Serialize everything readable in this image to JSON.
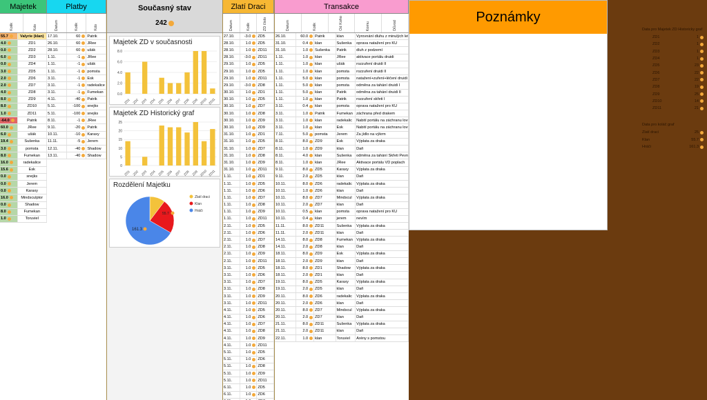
{
  "majetek": {
    "title": "Majetek",
    "h": [
      "Kolik",
      "Kdo"
    ],
    "rows": [
      [
        "55.7",
        "Valyrie (klan)"
      ],
      [
        "4.0",
        "ZD1"
      ],
      [
        "0.0",
        "ZD2"
      ],
      [
        "6.0",
        "ZD3"
      ],
      [
        "0.0",
        "ZD4"
      ],
      [
        "3.0",
        "ZD5"
      ],
      [
        "2.0",
        "ZD6"
      ],
      [
        "2.0",
        "ZD7"
      ],
      [
        "4.0",
        "ZD8"
      ],
      [
        "8.0",
        "ZD9"
      ],
      [
        "8.0",
        "ZD10"
      ],
      [
        "1.0",
        "ZD11"
      ],
      [
        "-64.0",
        "Patrik"
      ],
      [
        "60.0",
        "JRee"
      ],
      [
        "6.0",
        "ušák"
      ],
      [
        "19.4",
        "Sušenka"
      ],
      [
        "3.0",
        "pomsta"
      ],
      [
        "8.0",
        "Fumekan"
      ],
      [
        "16.0",
        "radekalice"
      ],
      [
        "15.6",
        "Esk"
      ],
      [
        "0.0",
        "snejks"
      ],
      [
        "0.0",
        "Jerem"
      ],
      [
        "0.0",
        "Karaxy"
      ],
      [
        "16.0",
        "Mindsculptor"
      ],
      [
        "0.0",
        "Shadow"
      ],
      [
        "8.0",
        "Fumekan"
      ],
      [
        "1.0",
        "Toruviel"
      ]
    ]
  },
  "platby": {
    "title": "Platby",
    "h": [
      "Datum",
      "Kolik",
      "Kdo"
    ],
    "rows": [
      [
        "17.10.",
        "60",
        "Patrik"
      ],
      [
        "26.10.",
        "60",
        "JRee"
      ],
      [
        "28.10.",
        "60",
        "ušák"
      ],
      [
        "1.11.",
        "-1",
        "JRee"
      ],
      [
        "1.11.",
        "-1",
        "ušák"
      ],
      [
        "1.11.",
        "-1",
        "pomsta"
      ],
      [
        "3.11.",
        "-1",
        "Esk"
      ],
      [
        "3.11.",
        "-1",
        "radekalice"
      ],
      [
        "3.11.",
        "-1",
        "Fumekan"
      ],
      [
        "4.11.",
        "-40",
        "Patrik"
      ],
      [
        "5.11.",
        "-100",
        "snejks"
      ],
      [
        "5.11.",
        "-100",
        "snejks"
      ],
      [
        "8.11.",
        "-1",
        "JRee"
      ],
      [
        "9.11.",
        "-20",
        "Patrik"
      ],
      [
        "10.11.",
        "-10",
        "Karaxy"
      ],
      [
        "11.11.",
        "-5",
        "Jerem"
      ],
      [
        "12.11.",
        "-40",
        "Shadow"
      ],
      [
        "13.11.",
        "-40",
        "Shadow"
      ]
    ]
  },
  "stav": {
    "title": "Současný stav",
    "value": "242"
  },
  "charts": {
    "c1_title": "Majetek ZD v současnosti",
    "c2_title": "Majetek ZD Historický graf",
    "c3_title": "Rozdělení Majetku",
    "pie_label1": "161.3",
    "pie_label2": "55.7"
  },
  "chart_data": [
    {
      "type": "bar",
      "categories": [
        "ZD1",
        "ZD2",
        "ZD3",
        "ZD4",
        "ZD5",
        "ZD6",
        "ZD7",
        "ZD8",
        "ZD9",
        "ZD10",
        "ZD11"
      ],
      "values": [
        4,
        0,
        6,
        0,
        3,
        2,
        2,
        4,
        8,
        8,
        1
      ],
      "ylim": [
        0,
        8
      ],
      "yticks": [
        "0.0",
        "2.0",
        "4.0",
        "6.0",
        "8.0"
      ],
      "color": "#f3c23b"
    },
    {
      "type": "bar",
      "categories": [
        "ZD1",
        "ZD2",
        "ZD3",
        "ZD4",
        "ZD5",
        "ZD6",
        "ZD7",
        "ZD8",
        "ZD9",
        "ZD10",
        "ZD11"
      ],
      "values": [
        14,
        0,
        5,
        0,
        23,
        22,
        22,
        19,
        25,
        14,
        21
      ],
      "ylim": [
        0,
        25
      ],
      "yticks": [
        "0",
        "5",
        "10",
        "15",
        "20",
        "25"
      ],
      "color": "#f3c23b"
    },
    {
      "type": "pie",
      "labels": [
        "Zlatí draci",
        "Klan",
        "Hráči"
      ],
      "values": [
        25,
        55.7,
        161.3
      ],
      "colors": [
        "#f3c23b",
        "#e8191d",
        "#4a86e8"
      ]
    }
  ],
  "draci": {
    "title": "Zlatí Draci",
    "h": [
      "Datum",
      "Kolik",
      "ZD číslo"
    ],
    "rows": [
      [
        "27.10.",
        "-3.0",
        "ZD5"
      ],
      [
        "28.10.",
        "1.0",
        "ZD5"
      ],
      [
        "28.10.",
        "1.0",
        "ZD11"
      ],
      [
        "28.10.",
        "-3.0",
        "ZD11"
      ],
      [
        "29.10.",
        "1.0",
        "ZD5"
      ],
      [
        "29.10.",
        "1.0",
        "ZD5"
      ],
      [
        "29.10.",
        "1.0",
        "ZD11"
      ],
      [
        "29.10.",
        "-3.0",
        "ZD8"
      ],
      [
        "30.10.",
        "1.0",
        "ZD1"
      ],
      [
        "30.10.",
        "1.0",
        "ZD5"
      ],
      [
        "30.10.",
        "1.0",
        "ZD7"
      ],
      [
        "30.10.",
        "1.0",
        "ZD8"
      ],
      [
        "30.10.",
        "1.0",
        "ZD9"
      ],
      [
        "30.10.",
        "1.0",
        "ZD9"
      ],
      [
        "31.10.",
        "1.0",
        "ZD1"
      ],
      [
        "31.10.",
        "1.0",
        "ZD5"
      ],
      [
        "31.10.",
        "1.0",
        "ZD7"
      ],
      [
        "31.10.",
        "1.0",
        "ZD8"
      ],
      [
        "31.10.",
        "1.0",
        "ZD9"
      ],
      [
        "31.10.",
        "1.0",
        "ZD11"
      ],
      [
        "1.11.",
        "1.0",
        "ZD1"
      ],
      [
        "1.11.",
        "1.0",
        "ZD5"
      ],
      [
        "1.11.",
        "1.0",
        "ZD6"
      ],
      [
        "1.11.",
        "1.0",
        "ZD7"
      ],
      [
        "1.11.",
        "1.0",
        "ZD8"
      ],
      [
        "1.11.",
        "1.0",
        "ZD9"
      ],
      [
        "1.11.",
        "1.0",
        "ZD11"
      ],
      [
        "2.11.",
        "1.0",
        "ZD5"
      ],
      [
        "2.11.",
        "1.0",
        "ZD6"
      ],
      [
        "2.11.",
        "1.0",
        "ZD7"
      ],
      [
        "2.11.",
        "1.0",
        "ZD8"
      ],
      [
        "2.11.",
        "1.0",
        "ZD9"
      ],
      [
        "2.11.",
        "1.0",
        "ZD11"
      ],
      [
        "3.11.",
        "1.0",
        "ZD5"
      ],
      [
        "3.11.",
        "1.0",
        "ZD6"
      ],
      [
        "3.11.",
        "1.0",
        "ZD7"
      ],
      [
        "3.11.",
        "1.0",
        "ZD8"
      ],
      [
        "3.11.",
        "1.0",
        "ZD9"
      ],
      [
        "3.11.",
        "1.0",
        "ZD11"
      ],
      [
        "4.11.",
        "1.0",
        "ZD5"
      ],
      [
        "4.11.",
        "1.0",
        "ZD6"
      ],
      [
        "4.11.",
        "1.0",
        "ZD7"
      ],
      [
        "4.11.",
        "1.0",
        "ZD8"
      ],
      [
        "4.11.",
        "1.0",
        "ZD9"
      ],
      [
        "4.11.",
        "1.0",
        "ZD11"
      ],
      [
        "5.11.",
        "1.0",
        "ZD5"
      ],
      [
        "5.11.",
        "1.0",
        "ZD6"
      ],
      [
        "5.11.",
        "1.0",
        "ZD8"
      ],
      [
        "5.11.",
        "1.0",
        "ZD9"
      ],
      [
        "5.11.",
        "1.0",
        "ZD11"
      ],
      [
        "6.11.",
        "1.0",
        "ZD5"
      ],
      [
        "6.11.",
        "1.0",
        "ZD6"
      ],
      [
        "6.11.",
        "1.0",
        "ZD7"
      ]
    ]
  },
  "transakce": {
    "title": "Transakce",
    "h": [
      "Datum",
      "Kolik",
      "Od Koho",
      "Komu",
      "Důvod"
    ],
    "rows": [
      [
        "26.10.",
        "60.0",
        "Patrik",
        "klan",
        "Vyrovnání dluhu z minulých let"
      ],
      [
        "31.10.",
        "0.4",
        "klan",
        "Sušenka",
        "oprava natažení pro KU"
      ],
      [
        "31.10.",
        "1.0",
        "Sušenka",
        "Patrik",
        "dluh z podzemí"
      ],
      [
        "1.11.",
        "1.0",
        "klan",
        "JRee",
        "aktivace portálu druidi"
      ],
      [
        "1.11.",
        "1.0",
        "klan",
        "ušák",
        "rozzuření druidi II"
      ],
      [
        "1.11.",
        "1.0",
        "klan",
        "pomsta",
        "rozzuření druidi II"
      ],
      [
        "1.11.",
        "5.0",
        "klan",
        "pomsta",
        "natažení+zuření+léčení druidi I"
      ],
      [
        "1.11.",
        "5.0",
        "klan",
        "pomsta",
        "odměna za tahání druidi I"
      ],
      [
        "1.11.",
        "5.0",
        "klan",
        "Patrik",
        "odměna za tahání druidi II"
      ],
      [
        "1.11.",
        "1.0",
        "klan",
        "Patrik",
        "rozzuření skřeti I"
      ],
      [
        "3.11.",
        "0.4",
        "klan",
        "pomsta",
        "oprava natažení pro KU"
      ],
      [
        "3.11.",
        "1.0",
        "Patrik",
        "Fumekan",
        "záchrana před drakem"
      ],
      [
        "3.11.",
        "1.0",
        "klan",
        "radekalic",
        "Nabití portálu na záchranu lovu"
      ],
      [
        "3.11.",
        "1.0",
        "klan",
        "Esk",
        "Nabití portálu na záchranu lovu"
      ],
      [
        "7.11.",
        "5.0",
        "pomsta",
        "Jerem",
        "Za jídlo na výkrm"
      ],
      [
        "8.11.",
        "8.0",
        "ZD9",
        "Esk",
        "Výplata za draka"
      ],
      [
        "8.11.",
        "1.0",
        "ZD9",
        "klan",
        "Daň"
      ],
      [
        "8.11.",
        "4.0",
        "klan",
        "Sušenka",
        "odměna za tahání Skřeti Pevno"
      ],
      [
        "8.11.",
        "1.0",
        "klan",
        "JRee",
        "Aktivace portálu VD poplach"
      ],
      [
        "9.11.",
        "8.0",
        "ZD5",
        "Karaxy",
        "Výplata za draka"
      ],
      [
        "9.11.",
        "2.0",
        "ZD5",
        "klan",
        "Daň"
      ],
      [
        "10.11.",
        "8.0",
        "ZD6",
        "radekalic",
        "Výplata za draka"
      ],
      [
        "10.11.",
        "1.0",
        "ZD6",
        "klan",
        "Daň"
      ],
      [
        "10.11.",
        "8.0",
        "ZD7",
        "Mindscul",
        "Výplata za draka"
      ],
      [
        "10.11.",
        "2.0",
        "ZD7",
        "klan",
        "Daň"
      ],
      [
        "10.11.",
        "0.5",
        "klan",
        "pomsta",
        "oprava natažení pro KU"
      ],
      [
        "10.11.",
        "0.4",
        "klan",
        "jerem",
        "nevím"
      ],
      [
        "11.11.",
        "8.0",
        "ZD11",
        "Sušenka",
        "Výplata za draka"
      ],
      [
        "11.11.",
        "2.0",
        "ZD11",
        "klan",
        "Daň"
      ],
      [
        "14.11.",
        "8.0",
        "ZD8",
        "Fumekan",
        "Výplata za draka"
      ],
      [
        "14.11.",
        "2.0",
        "ZD8",
        "klan",
        "Daň"
      ],
      [
        "18.11.",
        "8.0",
        "ZD9",
        "Esk",
        "Výplata za draka"
      ],
      [
        "18.11.",
        "2.0",
        "ZD9",
        "klan",
        "Daň"
      ],
      [
        "18.11.",
        "8.0",
        "ZD1",
        "Shadow",
        "Výplata za draka"
      ],
      [
        "18.11.",
        "2.0",
        "ZD1",
        "klan",
        "Daň"
      ],
      [
        "19.11.",
        "8.0",
        "ZD5",
        "Karaxy",
        "Výplata za draka"
      ],
      [
        "19.11.",
        "2.0",
        "ZD5",
        "klan",
        "Daň"
      ],
      [
        "20.11.",
        "8.0",
        "ZD6",
        "radekalic",
        "Výplata za draka"
      ],
      [
        "20.11.",
        "2.0",
        "ZD6",
        "klan",
        "Daň"
      ],
      [
        "20.11.",
        "8.0",
        "ZD7",
        "Mindscul",
        "Výplata za draka"
      ],
      [
        "20.11.",
        "2.0",
        "ZD7",
        "klan",
        "Daň"
      ],
      [
        "21.11.",
        "8.0",
        "ZD11",
        "Sušenka",
        "Výplata za draka"
      ],
      [
        "21.11.",
        "2.0",
        "ZD11",
        "klan",
        "Daň"
      ],
      [
        "22.11.",
        "1.0",
        "klan",
        "Toruviel",
        "Arény s pomstou"
      ]
    ]
  },
  "poznamky": {
    "title": "Poznámky"
  },
  "side": {
    "t1": "Data pro Majetek ZD Historicky graf",
    "rows": [
      [
        "ZD1",
        "1"
      ],
      [
        "ZD2",
        "1"
      ],
      [
        "ZD3",
        "1"
      ],
      [
        "ZD4",
        "1"
      ],
      [
        "ZD5",
        "23"
      ],
      [
        "ZD6",
        "22"
      ],
      [
        "ZD7",
        "22"
      ],
      [
        "ZD8",
        "19"
      ],
      [
        "ZD9",
        "25"
      ],
      [
        "ZD10",
        "14"
      ],
      [
        "ZD11",
        "21"
      ]
    ],
    "t2": "Data pro koláč graf",
    "rows2": [
      [
        "Zlatí draci",
        "25"
      ],
      [
        "Klan",
        "55.7"
      ],
      [
        "Hráči",
        "161.3"
      ]
    ]
  }
}
